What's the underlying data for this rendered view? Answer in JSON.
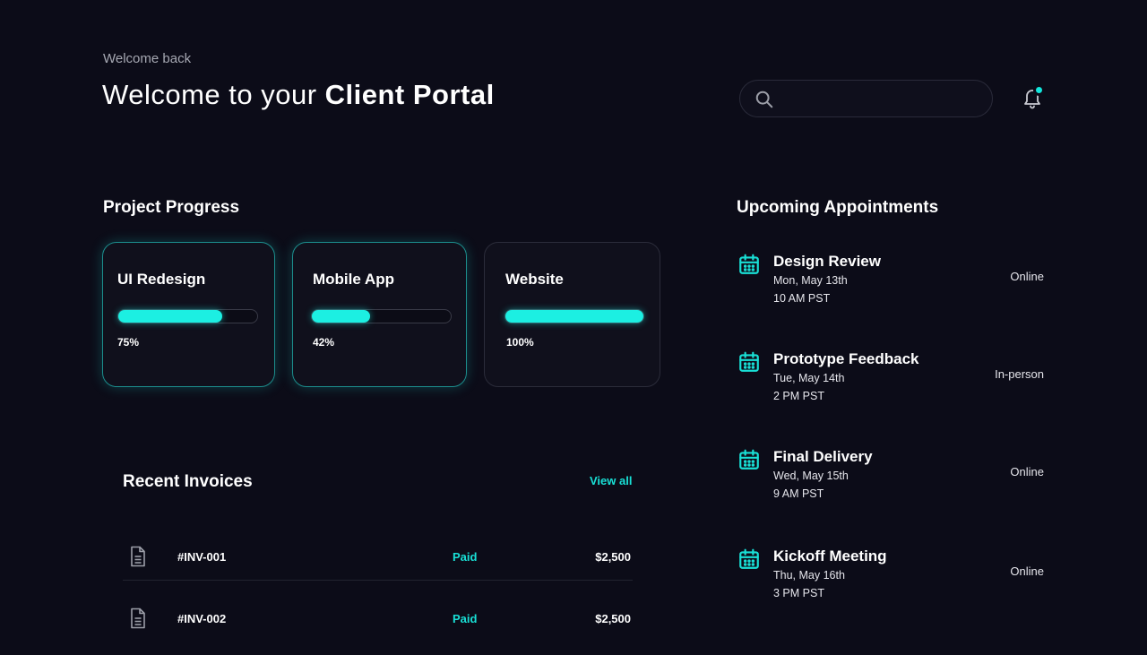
{
  "header": {
    "subtitle": "Welcome back",
    "title_prefix": "Welcome to your",
    "title_strong": "Client Portal",
    "search_placeholder": "",
    "search_icon": "search-icon",
    "notification_icon": "bell-icon"
  },
  "projects": {
    "title": "Project Progress",
    "items": [
      {
        "name": "UI Redesign",
        "progress": 75,
        "label": "75%"
      },
      {
        "name": "Mobile App",
        "progress": 42,
        "label": "42%"
      },
      {
        "name": "Website",
        "progress": 100,
        "label": "100%"
      }
    ]
  },
  "invoices": {
    "title": "Recent Invoices",
    "view_all": "View all",
    "rows": [
      {
        "id": "#INV-001",
        "status": "Paid",
        "amount": "$2,500",
        "icon": "document-icon"
      },
      {
        "id": "#INV-002",
        "status": "Paid",
        "amount": "$2,500",
        "icon": "document-icon"
      }
    ]
  },
  "appointments": {
    "title": "Upcoming Appointments",
    "items": [
      {
        "title": "Design Review",
        "date": "Mon, May 13th",
        "time": "10 AM PST",
        "location": "Online",
        "icon": "calendar-icon"
      },
      {
        "title": "Prototype Feedback",
        "date": "Tue, May 14th",
        "time": "2 PM PST",
        "location": "In-person",
        "icon": "calendar-icon"
      },
      {
        "title": "Final Delivery",
        "date": "Wed, May 15th",
        "time": "9 AM PST",
        "location": "Online",
        "icon": "calendar-icon"
      },
      {
        "title": "Kickoff Meeting",
        "date": "Thu, May 16th",
        "time": "3 PM PST",
        "location": "Online",
        "icon": "calendar-icon"
      }
    ]
  },
  "colors": {
    "background": "#0c0c18",
    "accent": "#1cefe2",
    "muted_text": "#a6a8b2",
    "card_border": "#2b2c3a"
  }
}
